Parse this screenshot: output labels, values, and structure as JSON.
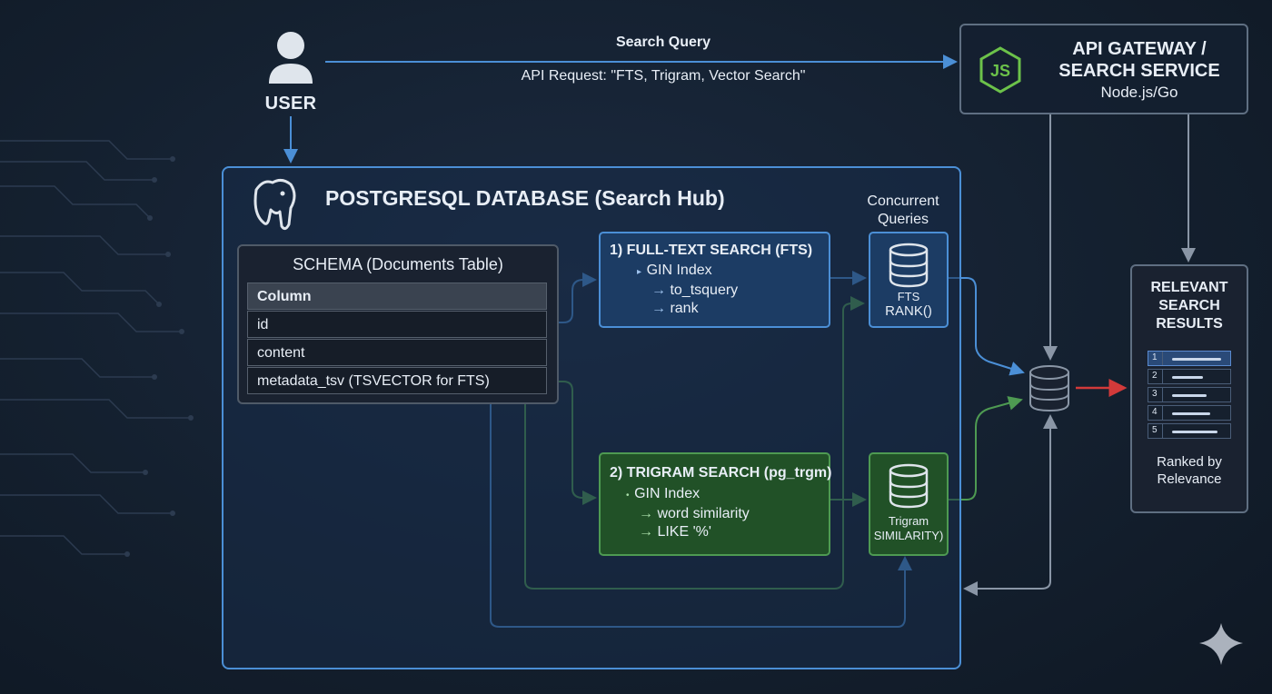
{
  "user": {
    "label": "USER",
    "icon": "user-icon"
  },
  "request_arrow": {
    "title": "Search Query",
    "subtitle": "API Request: \"FTS, Trigram, Vector Search\""
  },
  "api_gateway": {
    "title_line1": "API GATEWAY /",
    "title_line2": "SEARCH SERVICE",
    "subtitle": "Node.js/Go",
    "icon": "nodejs-icon"
  },
  "database": {
    "title": "POSTGRESQL DATABASE (Search Hub)",
    "icon": "postgres-elephant-icon",
    "concurrent_line1": "Concurrent",
    "concurrent_line2": "Queries"
  },
  "schema": {
    "title": "SCHEMA (Documents Table)",
    "rows": [
      "Column",
      "id",
      "content",
      "metadata_tsv  (TSVECTOR for FTS)"
    ]
  },
  "fts": {
    "title": "1) FULL-TEXT SEARCH (FTS)",
    "index": "GIN Index",
    "items": [
      "to_tsquery",
      "rank"
    ],
    "node_line1": "FTS",
    "node_line2": "RANK()"
  },
  "trigram": {
    "title": "2) TRIGRAM SEARCH (pg_trgm)",
    "index": "GIN Index",
    "items": [
      "word similarity",
      "LIKE '%'"
    ],
    "node_line1": "Trigram",
    "node_line2": "SIMILARITY)"
  },
  "results": {
    "title_line1": "RELEVANT",
    "title_line2": "SEARCH",
    "title_line3": "RESULTS",
    "ranks": [
      "1",
      "2",
      "3",
      "4",
      "5"
    ],
    "footer_line1": "Ranked by",
    "footer_line2": "Relevance"
  },
  "colors": {
    "blue": "#4b8fd6",
    "green": "#4e9a52",
    "red": "#d23a3a",
    "gray": "#8a96a6",
    "background": "#14202f"
  }
}
